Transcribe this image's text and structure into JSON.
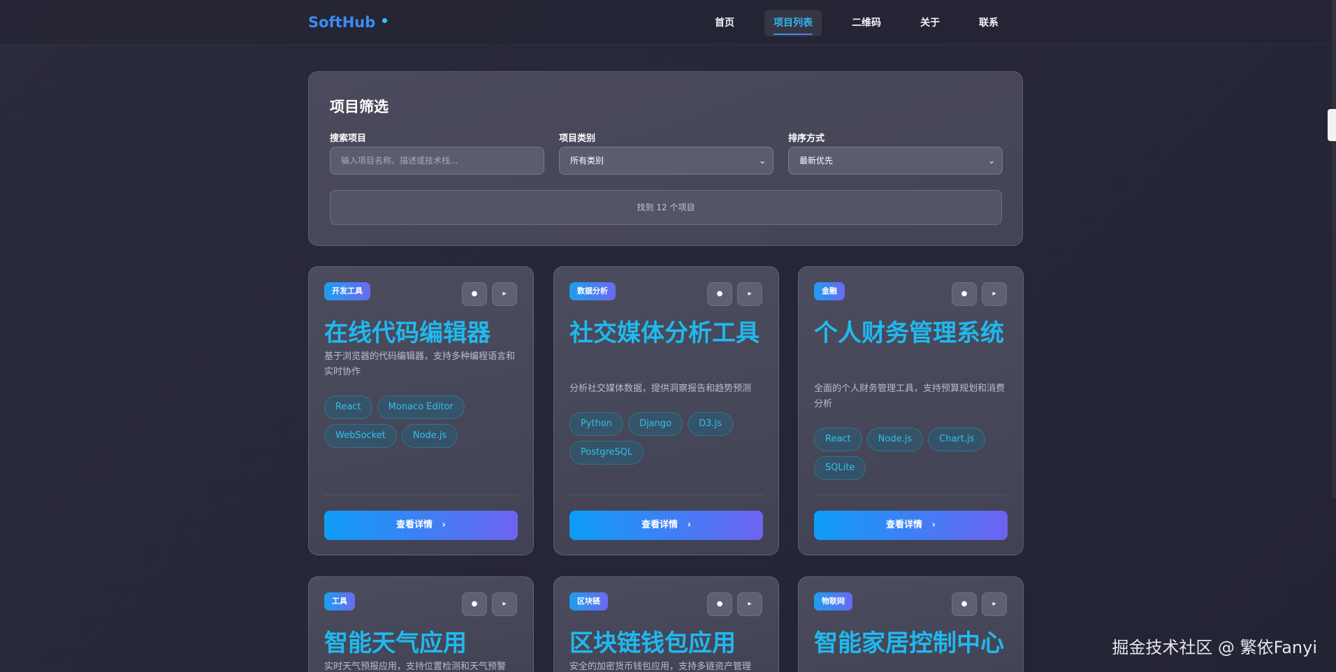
{
  "header": {
    "logo": "SoftHub",
    "nav": [
      {
        "label": "首页",
        "active": false
      },
      {
        "label": "项目列表",
        "active": true
      },
      {
        "label": "二维码",
        "active": false
      },
      {
        "label": "关于",
        "active": false
      },
      {
        "label": "联系",
        "active": false
      }
    ]
  },
  "filter": {
    "title": "项目筛选",
    "search_label": "搜索项目",
    "search_placeholder": "输入项目名称、描述或技术栈...",
    "category_label": "项目类别",
    "category_value": "所有类别",
    "sort_label": "排序方式",
    "sort_value": "最新优先",
    "result_text": "找到 12 个项目"
  },
  "cards": [
    {
      "badge": "开发工具",
      "title": "在线代码编辑器",
      "desc": "基于浏览器的代码编辑器，支持多种编程语言和实时协作",
      "tags": [
        "React",
        "Monaco Editor",
        "WebSocket",
        "Node.js"
      ],
      "button": "查看详情"
    },
    {
      "badge": "数据分析",
      "title": "社交媒体分析工具",
      "desc": "分析社交媒体数据，提供洞察报告和趋势预测",
      "tags": [
        "Python",
        "Django",
        "D3.js",
        "PostgreSQL"
      ],
      "button": "查看详情"
    },
    {
      "badge": "金融",
      "title": "个人财务管理系统",
      "desc": "全面的个人财务管理工具，支持预算规划和消费分析",
      "tags": [
        "React",
        "Node.js",
        "Chart.js",
        "SQLite"
      ],
      "button": "查看详情"
    },
    {
      "badge": "工具",
      "title": "智能天气应用",
      "desc": "实时天气预报应用，支持位置检测和天气预警",
      "tags": [],
      "button": ""
    },
    {
      "badge": "区块链",
      "title": "区块链钱包应用",
      "desc": "安全的加密货币钱包应用，支持多链资产管理",
      "tags": [],
      "button": ""
    },
    {
      "badge": "物联网",
      "title": "智能家居控制中心",
      "desc": "",
      "tags": [],
      "button": ""
    }
  ],
  "watermark": "掘金技术社区 @ 繁依Fanyi",
  "icons": {
    "favorite": "heart-icon",
    "share": "play-icon",
    "detail_arrow": "chevron-right-icon",
    "select": "chevron-down-icon"
  }
}
